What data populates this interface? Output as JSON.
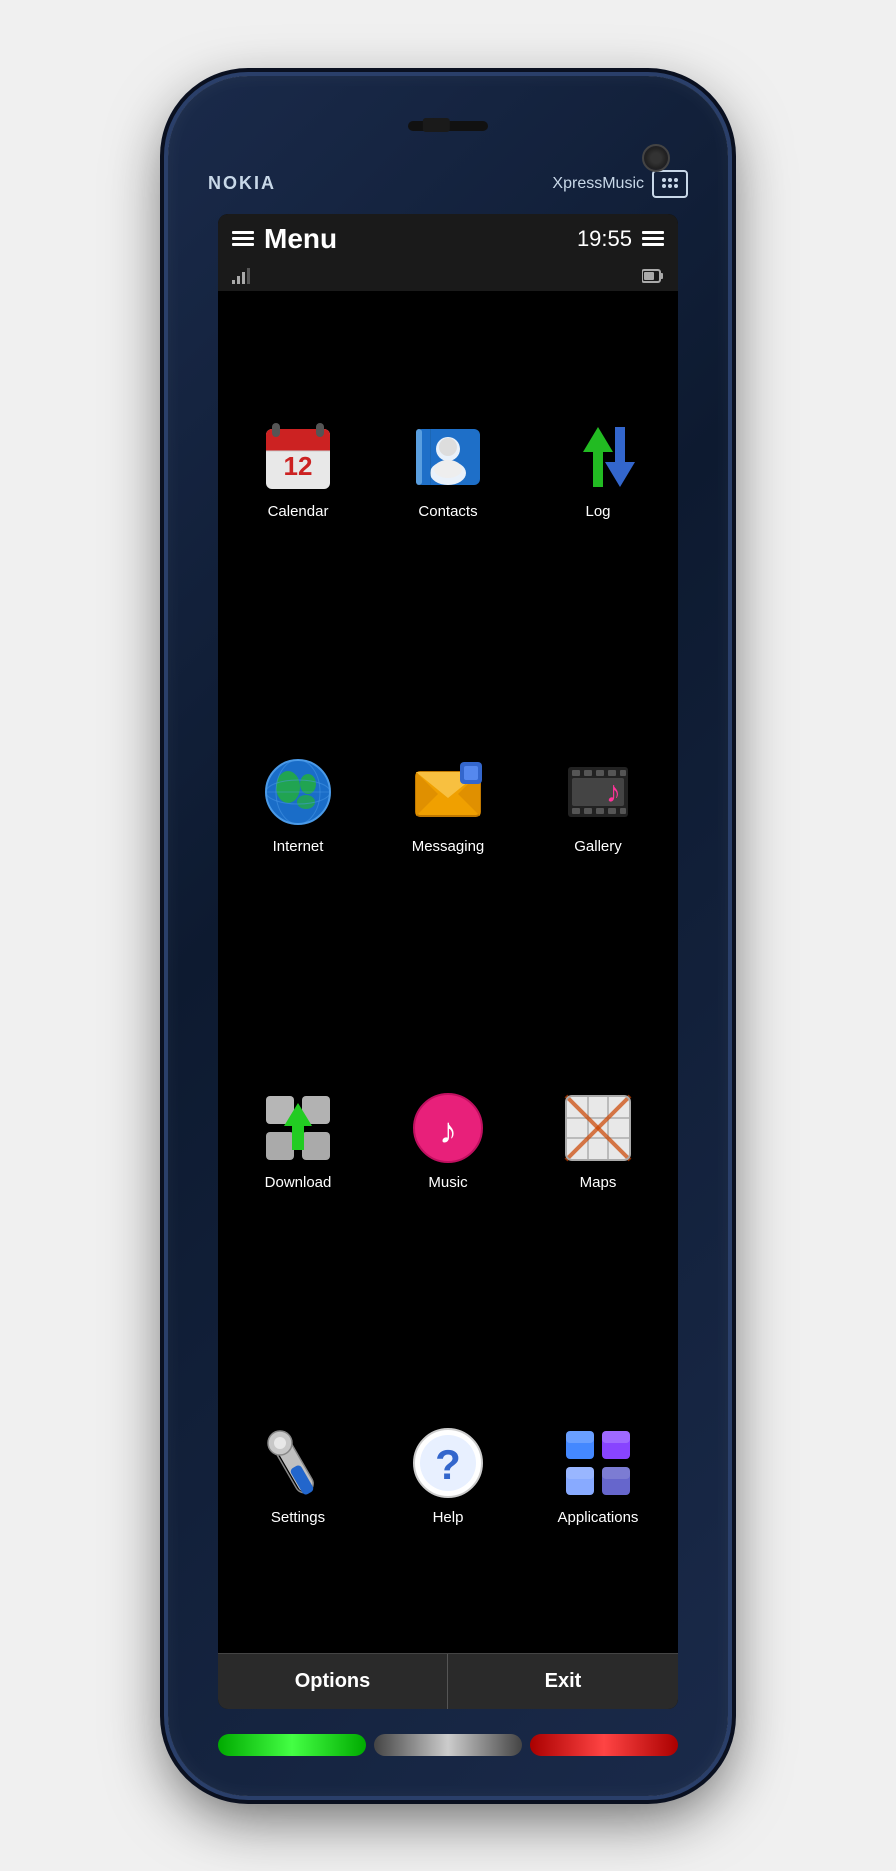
{
  "phone": {
    "brand": "NOKIA",
    "model": "XpressMusic",
    "status_bar": {
      "menu_label": "Menu",
      "time": "19:55"
    },
    "bottom_buttons": {
      "options": "Options",
      "exit": "Exit"
    }
  },
  "apps": [
    {
      "id": "calendar",
      "label": "Calendar"
    },
    {
      "id": "contacts",
      "label": "Contacts"
    },
    {
      "id": "log",
      "label": "Log"
    },
    {
      "id": "internet",
      "label": "Internet"
    },
    {
      "id": "messaging",
      "label": "Messaging"
    },
    {
      "id": "gallery",
      "label": "Gallery"
    },
    {
      "id": "download",
      "label": "Download"
    },
    {
      "id": "music",
      "label": "Music"
    },
    {
      "id": "maps",
      "label": "Maps"
    },
    {
      "id": "settings",
      "label": "Settings"
    },
    {
      "id": "help",
      "label": "Help"
    },
    {
      "id": "applications",
      "label": "Applications"
    }
  ]
}
